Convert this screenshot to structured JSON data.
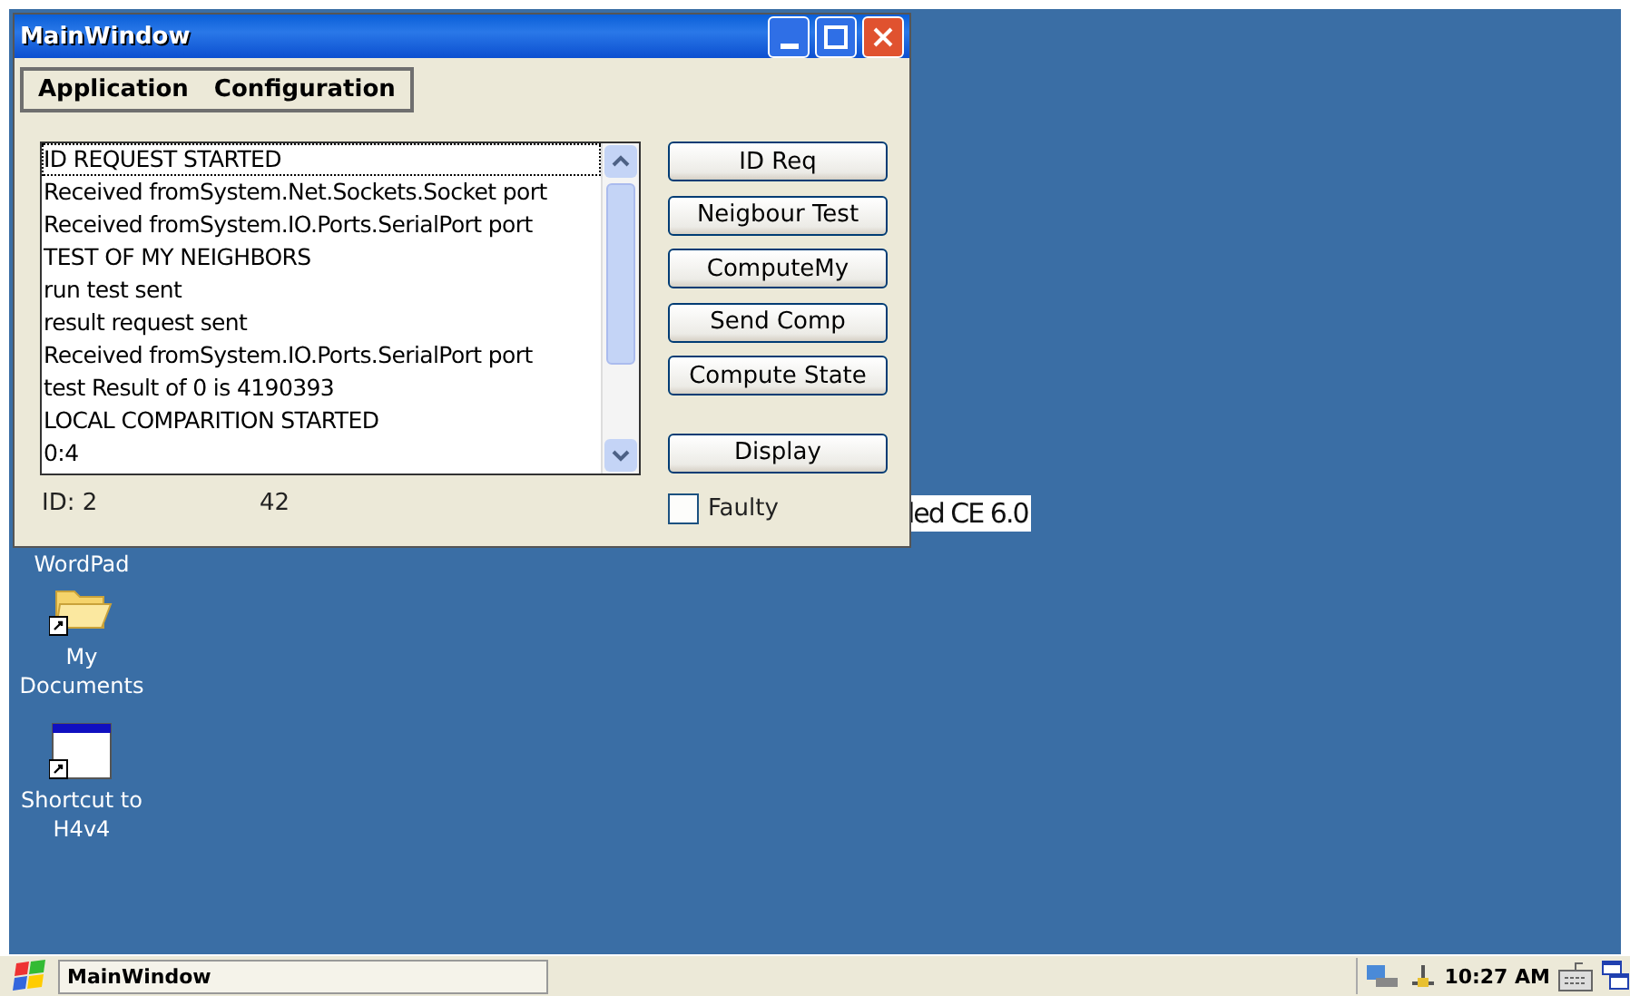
{
  "window": {
    "title": "MainWindow",
    "menu": [
      "Application",
      "Configuration"
    ],
    "log": [
      "ID REQUEST STARTED",
      "Received fromSystem.Net.Sockets.Socket port",
      "Received fromSystem.IO.Ports.SerialPort port",
      "TEST OF MY NEIGHBORS",
      "run test sent",
      "result request sent",
      "Received fromSystem.IO.Ports.SerialPort port",
      "test Result of 0 is 4190393",
      "LOCAL COMPARITION STARTED",
      "0:4"
    ],
    "buttons": [
      "ID Req",
      "Neigbour Test",
      "ComputeMy",
      "Send Comp",
      "Compute State",
      "Display"
    ],
    "id_label": "ID: 2",
    "value": "42",
    "faulty": {
      "label": "Faulty",
      "checked": false
    }
  },
  "desktop": {
    "wallpaper_text": "led CE 6.0",
    "icons": [
      {
        "kind": "hidden",
        "label": "WordPad"
      },
      {
        "kind": "folder",
        "label": "My\nDocuments"
      },
      {
        "kind": "app",
        "label": "Shortcut to\nH4v4"
      }
    ]
  },
  "taskbar": {
    "task": "MainWindow",
    "clock": "10:27 AM"
  }
}
